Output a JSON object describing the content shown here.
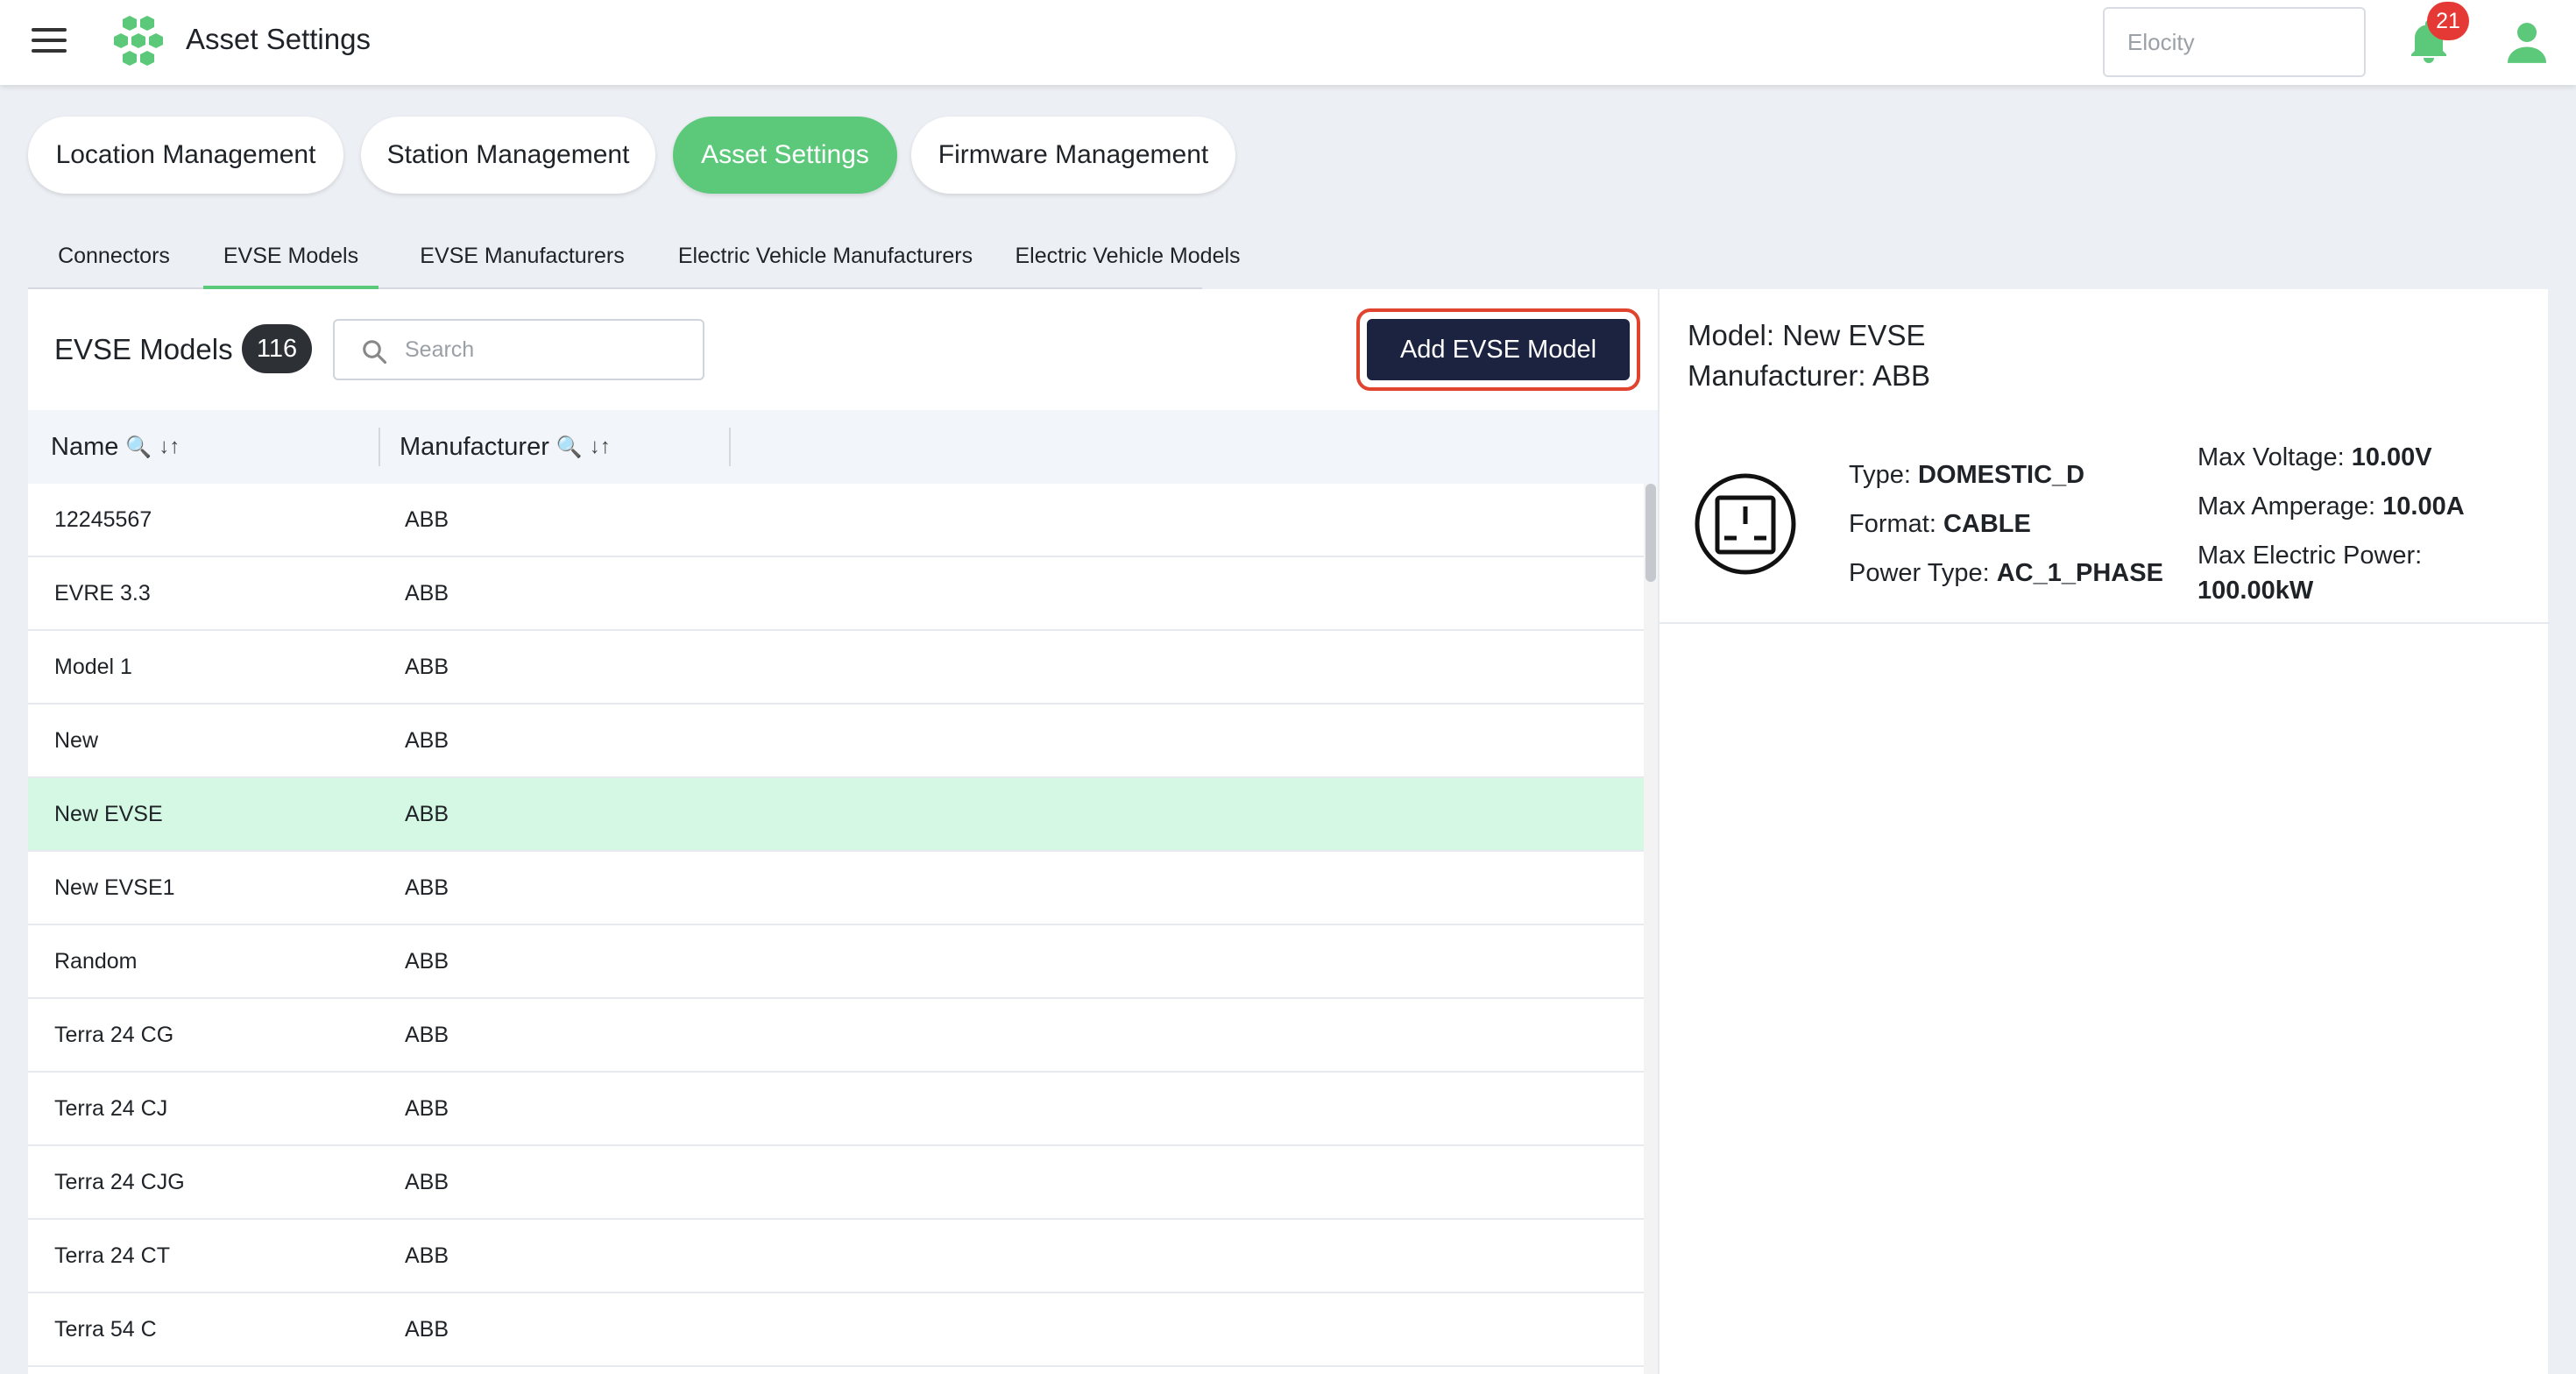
{
  "header": {
    "app_title": "Asset Settings",
    "tenant_placeholder": "Elocity",
    "notification_count": "21"
  },
  "primary_tabs": [
    {
      "label": "Location Management",
      "active": false
    },
    {
      "label": "Station Management",
      "active": false
    },
    {
      "label": "Asset Settings",
      "active": true
    },
    {
      "label": "Firmware Management",
      "active": false
    }
  ],
  "sub_tabs": [
    {
      "label": "Connectors",
      "active": false
    },
    {
      "label": "EVSE Models",
      "active": true
    },
    {
      "label": "EVSE Manufacturers",
      "active": false
    },
    {
      "label": "Electric Vehicle Manufacturers",
      "active": false
    },
    {
      "label": "Electric Vehicle Models",
      "active": false
    }
  ],
  "list": {
    "title": "EVSE Models",
    "count": "116",
    "search_placeholder": "Search",
    "add_button_label": "Add EVSE Model",
    "columns": [
      "Name",
      "Manufacturer"
    ],
    "rows": [
      {
        "name": "12245567",
        "manufacturer": "ABB"
      },
      {
        "name": "EVRE 3.3",
        "manufacturer": "ABB"
      },
      {
        "name": "Model 1",
        "manufacturer": "ABB"
      },
      {
        "name": "New",
        "manufacturer": "ABB"
      },
      {
        "name": "New EVSE",
        "manufacturer": "ABB",
        "selected": true
      },
      {
        "name": "New EVSE1",
        "manufacturer": "ABB"
      },
      {
        "name": "Random",
        "manufacturer": "ABB"
      },
      {
        "name": "Terra 24 CG",
        "manufacturer": "ABB"
      },
      {
        "name": "Terra 24 CJ",
        "manufacturer": "ABB"
      },
      {
        "name": "Terra 24 CJG",
        "manufacturer": "ABB"
      },
      {
        "name": "Terra 24 CT",
        "manufacturer": "ABB"
      },
      {
        "name": "Terra 54 C",
        "manufacturer": "ABB"
      }
    ]
  },
  "detail": {
    "model_label": "Model:",
    "model_value": "New EVSE",
    "manufacturer_label": "Manufacturer:",
    "manufacturer_value": "ABB",
    "type_label": "Type:",
    "type_value": "DOMESTIC_D",
    "format_label": "Format:",
    "format_value": "CABLE",
    "power_type_label": "Power Type:",
    "power_type_value": "AC_1_PHASE",
    "max_voltage_label": "Max Voltage:",
    "max_voltage_value": "10.00V",
    "max_amperage_label": "Max Amperage:",
    "max_amperage_value": "10.00A",
    "max_power_label": "Max Electric Power:",
    "max_power_value": "100.00kW"
  },
  "colors": {
    "accent_green": "#5cc87a",
    "selected_row": "#d4f8e3",
    "primary_button": "#1b2340",
    "highlight_ring": "#e0442e",
    "badge_red": "#e53935"
  },
  "icons": [
    "hamburger-menu-icon",
    "app-logo-icon",
    "bell-icon",
    "user-icon",
    "search-icon",
    "filter-search-icon",
    "sort-icon",
    "socket-connector-icon"
  ]
}
